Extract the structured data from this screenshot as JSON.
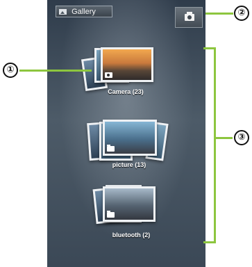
{
  "header": {
    "gallery_label": "Gallery"
  },
  "albums": [
    {
      "name": "Camera",
      "count": "23",
      "label": "Camera (23)"
    },
    {
      "name": "picture",
      "count": "13",
      "label": "picture (13)"
    },
    {
      "name": "bluetooth",
      "count": "2",
      "label": "bluetooth (2)"
    }
  ],
  "callouts": [
    "①",
    "②",
    "③"
  ],
  "icons": [
    "gallery-icon",
    "camera-icon",
    "folder-icon"
  ],
  "colors": {
    "callout_line": "#8dc63f"
  }
}
